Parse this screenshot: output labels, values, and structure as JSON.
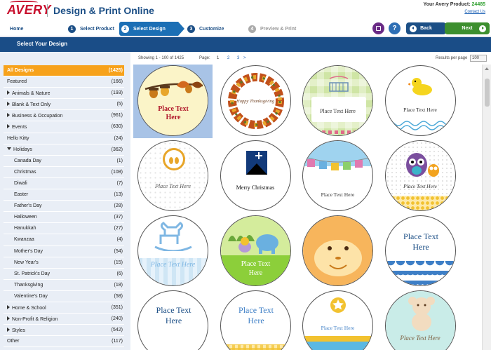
{
  "header": {
    "logo": "AVERY",
    "app_title": "Design & Print Online",
    "product_label": "Your Avery Product:",
    "product_number": "24485",
    "contact": "Contact Us"
  },
  "steps": {
    "home": "Home",
    "s1": {
      "num": "1",
      "label": "Select Product"
    },
    "s2": {
      "num": "2",
      "label": "Select Design"
    },
    "s3": {
      "num": "3",
      "label": "Customize"
    },
    "s4": {
      "num": "4",
      "label": "Preview & Print"
    },
    "back": "Back",
    "next": "Next",
    "help": "?"
  },
  "section_title": "Select Your Design",
  "sidebar": {
    "categories": [
      {
        "label": "All Designs",
        "count": "(1425)",
        "kind": "active"
      },
      {
        "label": "Featured",
        "count": "(166)",
        "kind": "top"
      },
      {
        "label": "Animals & Nature",
        "count": "(193)",
        "kind": "collapsed"
      },
      {
        "label": "Blank & Text Only",
        "count": "(5)",
        "kind": "collapsed"
      },
      {
        "label": "Business & Occupation",
        "count": "(961)",
        "kind": "collapsed"
      },
      {
        "label": "Events",
        "count": "(630)",
        "kind": "collapsed"
      },
      {
        "label": "Hello Kitty",
        "count": "(24)",
        "kind": "top"
      },
      {
        "label": "Holidays",
        "count": "(362)",
        "kind": "expanded"
      },
      {
        "label": "Canada Day",
        "count": "(1)",
        "kind": "sub"
      },
      {
        "label": "Christmas",
        "count": "(108)",
        "kind": "sub"
      },
      {
        "label": "Diwali",
        "count": "(7)",
        "kind": "sub"
      },
      {
        "label": "Easter",
        "count": "(13)",
        "kind": "sub"
      },
      {
        "label": "Father's Day",
        "count": "(28)",
        "kind": "sub"
      },
      {
        "label": "Halloween",
        "count": "(37)",
        "kind": "sub"
      },
      {
        "label": "Hanukkah",
        "count": "(27)",
        "kind": "sub"
      },
      {
        "label": "Kwanzaa",
        "count": "(4)",
        "kind": "sub"
      },
      {
        "label": "Mother's Day",
        "count": "(54)",
        "kind": "sub"
      },
      {
        "label": "New Year's",
        "count": "(15)",
        "kind": "sub"
      },
      {
        "label": "St. Patrick's Day",
        "count": "(6)",
        "kind": "sub"
      },
      {
        "label": "Thanksgiving",
        "count": "(18)",
        "kind": "sub"
      },
      {
        "label": "Valentine's Day",
        "count": "(58)",
        "kind": "sub"
      },
      {
        "label": "Home & School",
        "count": "(351)",
        "kind": "collapsed"
      },
      {
        "label": "Non-Profit & Religion",
        "count": "(240)",
        "kind": "collapsed"
      },
      {
        "label": "Styles",
        "count": "(542)",
        "kind": "collapsed"
      },
      {
        "label": "Other",
        "count": "(117)",
        "kind": "top"
      }
    ]
  },
  "results": {
    "showing": "Showing  1 - 100  of  1425",
    "page_label": "Page:",
    "pages": [
      "1",
      "2",
      "3",
      ">"
    ],
    "per_page_label": "Results per page",
    "per_page_value": "100"
  },
  "designs": [
    {
      "id": "acorns",
      "text": "Place Text Here"
    },
    {
      "id": "wreath",
      "text": "Happy Thanksgiving"
    },
    {
      "id": "crib",
      "text": "Place Text Here"
    },
    {
      "id": "duck",
      "text": "Place Text Here"
    },
    {
      "id": "feet",
      "text": "Place Text Here"
    },
    {
      "id": "nativity",
      "text": "Merry Christmas"
    },
    {
      "id": "baby-bunting",
      "text": "Place Text Here"
    },
    {
      "id": "owls",
      "text": "Place Text Here"
    },
    {
      "id": "rocking-horse",
      "text": "Place Text Here"
    },
    {
      "id": "safari",
      "text": "Place Text Here"
    },
    {
      "id": "monkey",
      "text": ""
    },
    {
      "id": "blue-scallop",
      "text": "Place Text Here"
    },
    {
      "id": "blue-stripe",
      "text": "Place Text Here"
    },
    {
      "id": "gingham",
      "text": "Place Text Here"
    },
    {
      "id": "star",
      "text": "Place Text Here"
    },
    {
      "id": "teddy",
      "text": "Place Text Here"
    }
  ]
}
